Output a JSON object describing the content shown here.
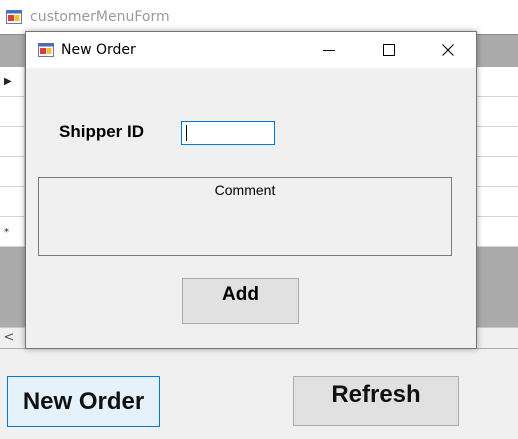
{
  "parent_window": {
    "title": "customerMenuForm",
    "icon": "winforms-app-icon"
  },
  "grid": {
    "rows": [
      {
        "marker": "▶"
      },
      {
        "marker": ""
      },
      {
        "marker": ""
      },
      {
        "marker": ""
      },
      {
        "marker": ""
      },
      {
        "marker": "*"
      }
    ],
    "scroll_left": "<"
  },
  "buttons": {
    "new_order": "New Order",
    "refresh": "Refresh"
  },
  "dialog": {
    "title": "New Order",
    "icon": "winforms-app-icon",
    "controls": [
      "minimize-icon",
      "maximize-icon",
      "close-icon"
    ],
    "shipper_label": "Shipper ID",
    "shipper_value": "",
    "comment_label": "Comment",
    "add_label": "Add"
  },
  "colors": {
    "focus_border": "#0078d7",
    "grid_background": "#ababab",
    "window_background": "#f0f0f0"
  }
}
